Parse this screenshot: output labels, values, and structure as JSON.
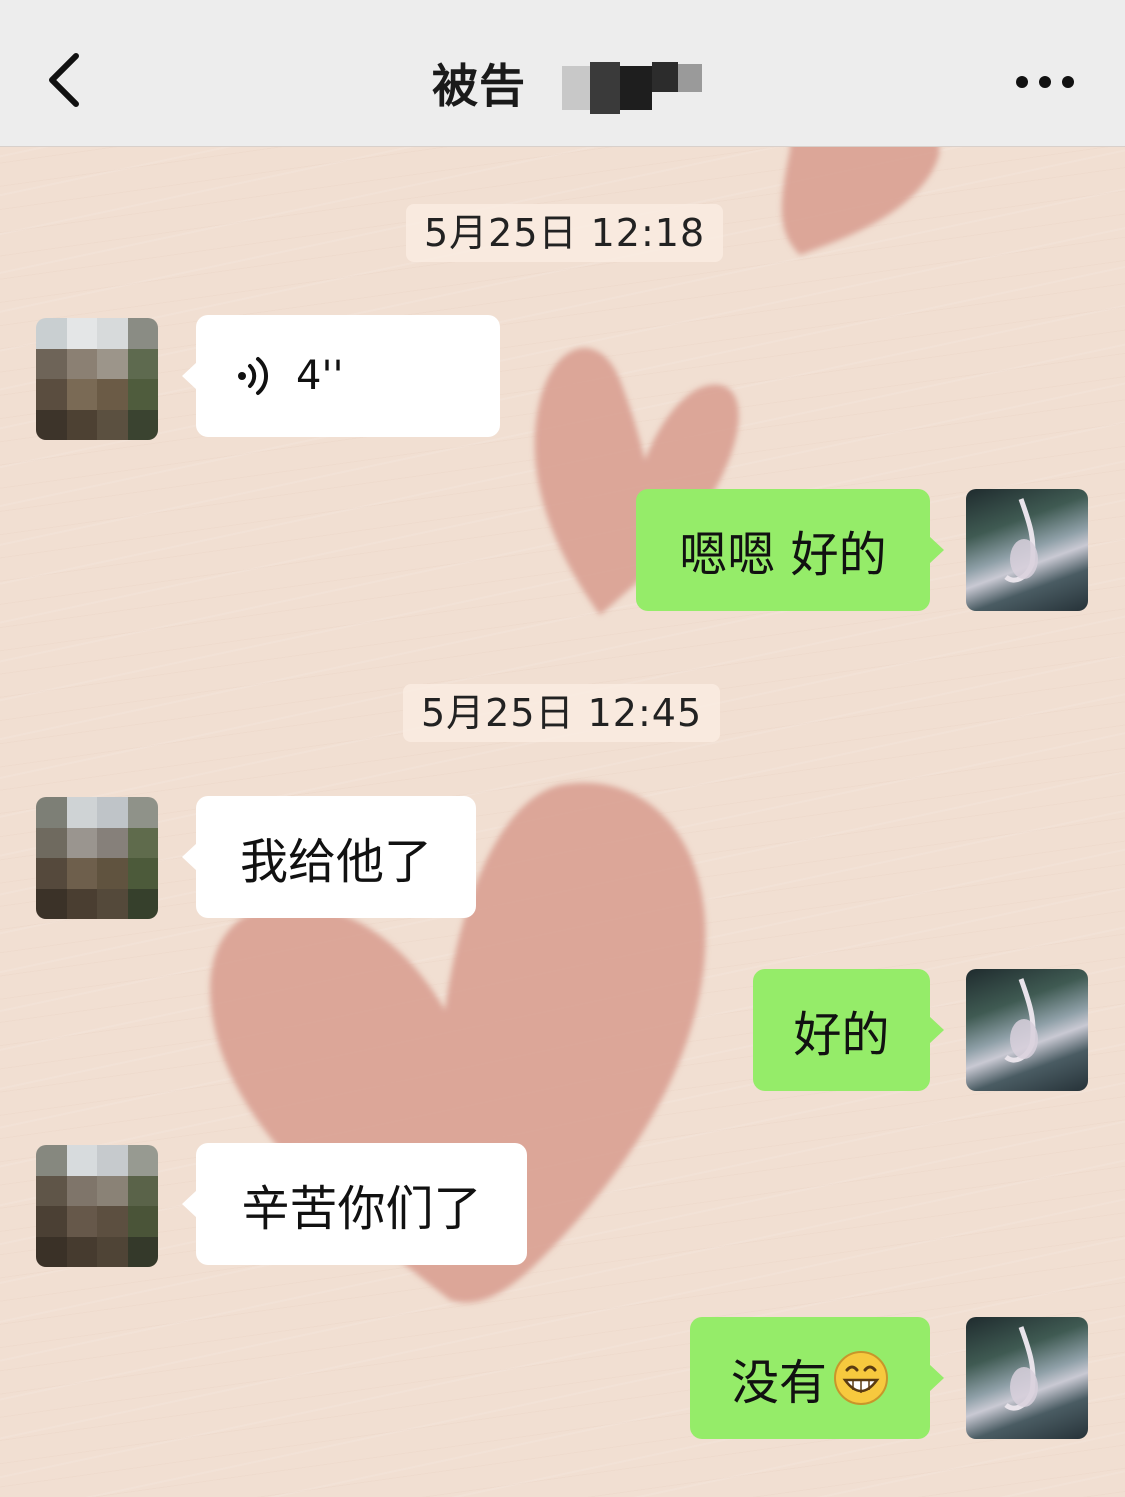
{
  "header": {
    "back_icon": "chevron-left-icon",
    "title": "被告",
    "more_icon": "more-dots-icon"
  },
  "messages": [
    {
      "type": "timestamp",
      "text": "5月25日 12:18"
    },
    {
      "type": "voice",
      "side": "incoming",
      "duration": "4''",
      "icon": "voice-wave-icon"
    },
    {
      "type": "text",
      "side": "outgoing",
      "text": "嗯嗯 好的"
    },
    {
      "type": "timestamp",
      "text": "5月25日 12:45"
    },
    {
      "type": "text",
      "side": "incoming",
      "text": "我给他了"
    },
    {
      "type": "text",
      "side": "outgoing",
      "text": "好的"
    },
    {
      "type": "text",
      "side": "incoming",
      "text": "辛苦你们了"
    },
    {
      "type": "text",
      "side": "outgoing",
      "text": "没有",
      "emoji": "grin-emoji-icon"
    }
  ],
  "colors": {
    "background": "#f1dfd2",
    "heart": "#d89c8e",
    "navbar": "#ededed",
    "incoming_bubble": "#ffffff",
    "outgoing_bubble": "#95ec69"
  }
}
